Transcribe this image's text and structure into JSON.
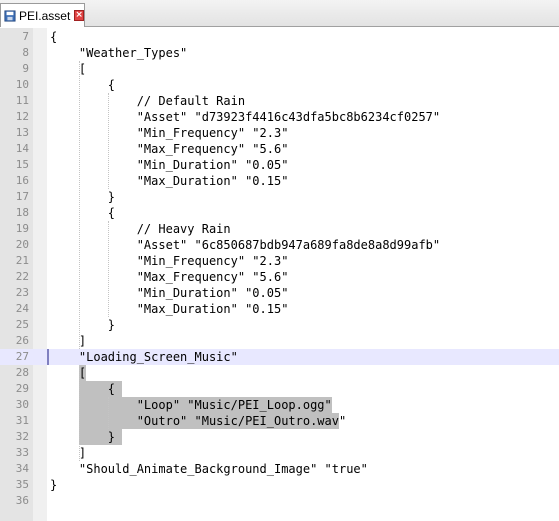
{
  "tab": {
    "file_name": "PEI.asset",
    "icon": "file-save-icon",
    "close_icon": "close-icon",
    "close_color": "#e04343"
  },
  "editor": {
    "current_line": 27,
    "selection_color": "#c0c0c0",
    "current_line_color": "#e8e8ff",
    "lines": [
      {
        "num": "7",
        "text": "{"
      },
      {
        "num": "8",
        "text": "    \"Weather_Types\""
      },
      {
        "num": "9",
        "text": "    ["
      },
      {
        "num": "10",
        "text": "        {"
      },
      {
        "num": "11",
        "text": "            // Default Rain"
      },
      {
        "num": "12",
        "text": "            \"Asset\" \"d73923f4416c43dfa5bc8b6234cf0257\""
      },
      {
        "num": "13",
        "text": "            \"Min_Frequency\" \"2.3\""
      },
      {
        "num": "14",
        "text": "            \"Max_Frequency\" \"5.6\""
      },
      {
        "num": "15",
        "text": "            \"Min_Duration\" \"0.05\""
      },
      {
        "num": "16",
        "text": "            \"Max_Duration\" \"0.15\""
      },
      {
        "num": "17",
        "text": "        }"
      },
      {
        "num": "18",
        "text": "        {"
      },
      {
        "num": "19",
        "text": "            // Heavy Rain"
      },
      {
        "num": "20",
        "text": "            \"Asset\" \"6c850687bdb947a689fa8de8a8d99afb\""
      },
      {
        "num": "21",
        "text": "            \"Min_Frequency\" \"2.3\""
      },
      {
        "num": "22",
        "text": "            \"Max_Frequency\" \"5.6\""
      },
      {
        "num": "23",
        "text": "            \"Min_Duration\" \"0.05\""
      },
      {
        "num": "24",
        "text": "            \"Max_Duration\" \"0.15\""
      },
      {
        "num": "25",
        "text": "        }"
      },
      {
        "num": "26",
        "text": "    ]"
      },
      {
        "num": "27",
        "text": "    \"Loading_Screen_Music\""
      },
      {
        "num": "28",
        "text": "    ["
      },
      {
        "num": "29",
        "text": "        {"
      },
      {
        "num": "30",
        "text": "            \"Loop\" \"Music/PEI_Loop.ogg\""
      },
      {
        "num": "31",
        "text": "            \"Outro\" \"Music/PEI_Outro.wav\""
      },
      {
        "num": "32",
        "text": "        }"
      },
      {
        "num": "33",
        "text": "    ]"
      },
      {
        "num": "34",
        "text": "    \"Should_Animate_Background_Image\" \"true\""
      },
      {
        "num": "35",
        "text": "}"
      },
      {
        "num": "36",
        "text": ""
      }
    ]
  }
}
